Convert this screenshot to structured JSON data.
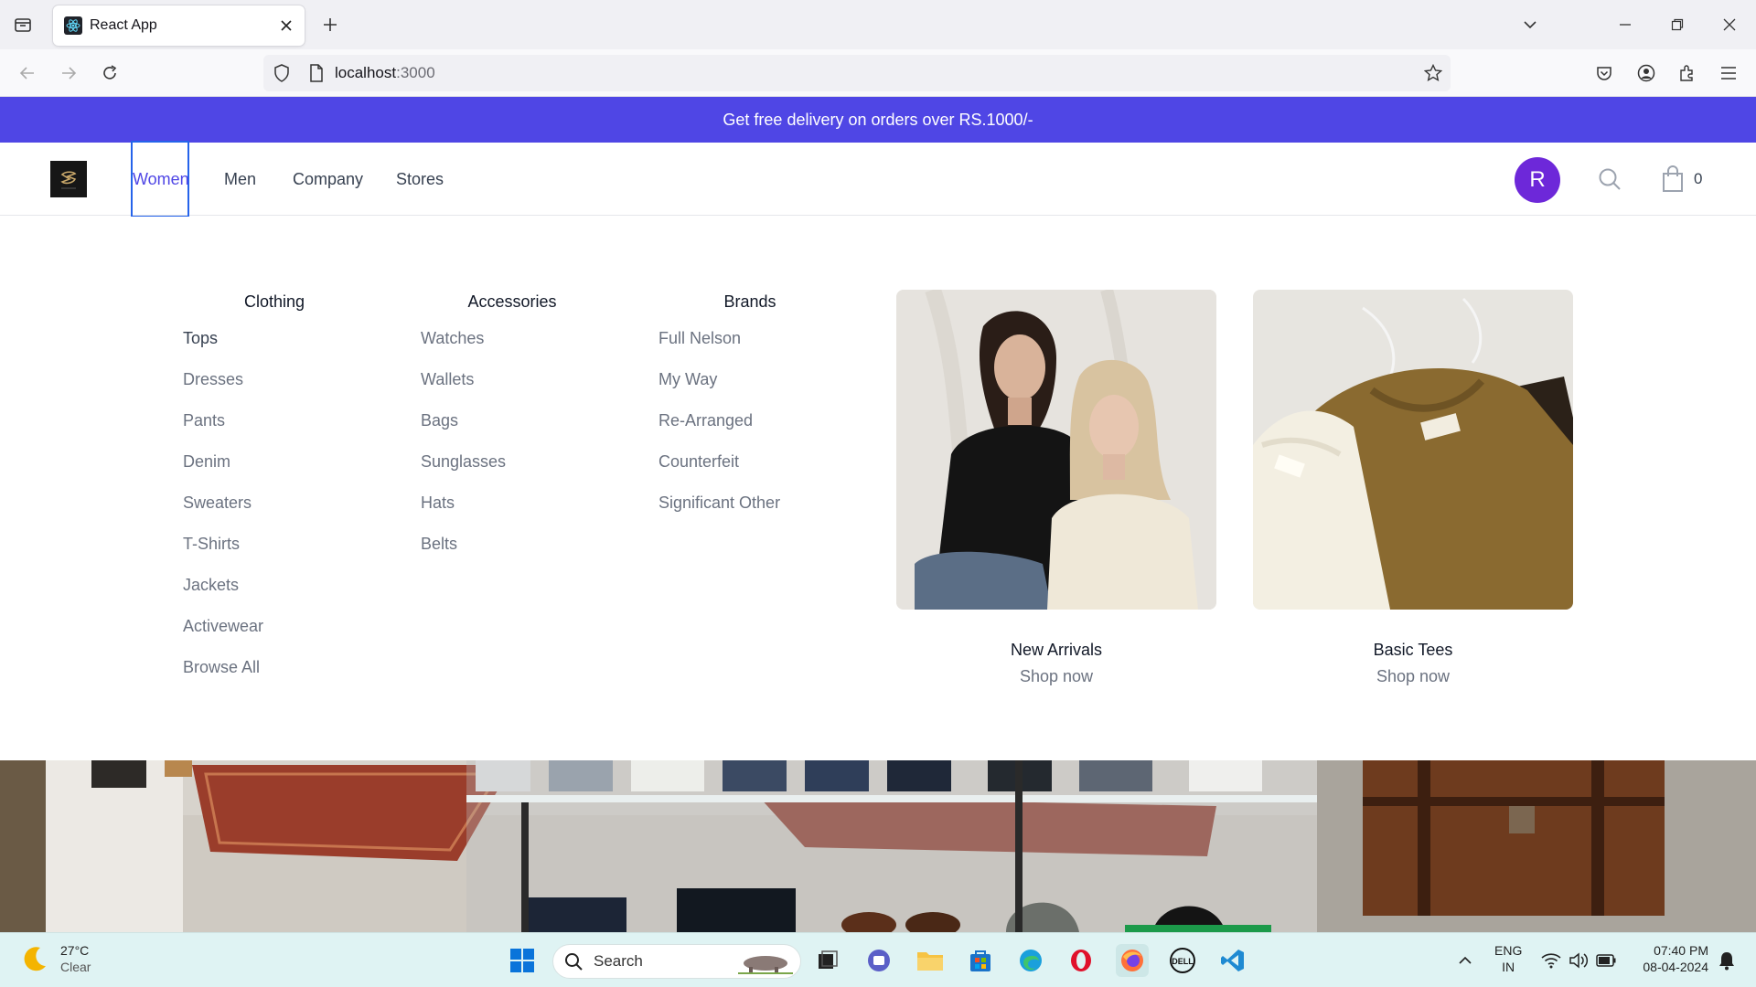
{
  "browser": {
    "tab_title": "React App",
    "url_host": "localhost",
    "url_port": ":3000"
  },
  "promo": {
    "text": "Get free delivery on orders over RS.1000/-"
  },
  "header": {
    "menu": [
      "Women",
      "Men",
      "Company",
      "Stores"
    ],
    "avatar_letter": "R",
    "cart_count": "0"
  },
  "dropdown": {
    "columns": [
      {
        "title": "Clothing",
        "items": [
          "Tops",
          "Dresses",
          "Pants",
          "Denim",
          "Sweaters",
          "T-Shirts",
          "Jackets",
          "Activewear",
          "Browse All"
        ]
      },
      {
        "title": "Accessories",
        "items": [
          "Watches",
          "Wallets",
          "Bags",
          "Sunglasses",
          "Hats",
          "Belts"
        ]
      },
      {
        "title": "Brands",
        "items": [
          "Full Nelson",
          "My Way",
          "Re-Arranged",
          "Counterfeit",
          "Significant Other"
        ]
      }
    ],
    "features": [
      {
        "name": "New Arrivals",
        "cta": "Shop now"
      },
      {
        "name": "Basic Tees",
        "cta": "Shop now"
      }
    ]
  },
  "taskbar": {
    "temperature": "27°C",
    "weather": "Clear",
    "search_placeholder": "Search",
    "lang_1": "ENG",
    "lang_2": "IN",
    "time": "07:40 PM",
    "date": "08-04-2024"
  },
  "colors": {
    "brand": "#4f46e5",
    "avatar": "#6d28d9",
    "taskbar": "#dff3f3"
  }
}
